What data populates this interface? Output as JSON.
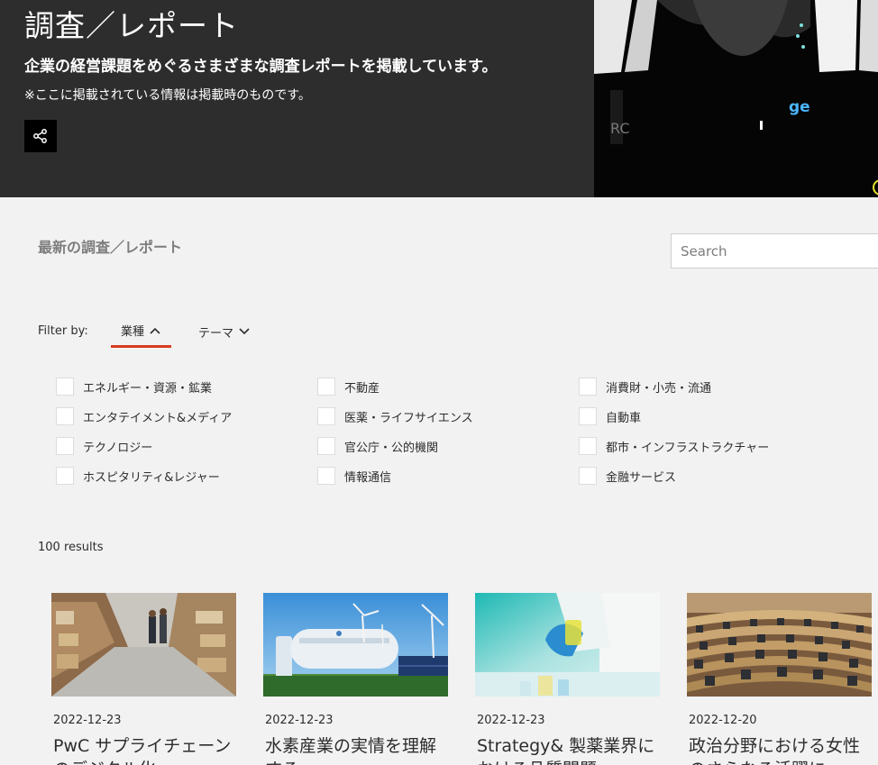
{
  "hero": {
    "title": "調査／レポート",
    "subtitle": "企業の経営課題をめぐるさまざまな調査レポートを掲載しています。",
    "note": "※ここに掲載されている情報は掲載時のものです。",
    "image_caption": "ge"
  },
  "section": {
    "title": "最新の調査／レポート",
    "search_placeholder": "Search"
  },
  "filter": {
    "label": "Filter by:",
    "tabs": [
      {
        "label": "業種"
      },
      {
        "label": "テーマ"
      }
    ],
    "accent_color": "#d93b1f"
  },
  "industries": [
    "エネルギー・資源・鉱業",
    "不動産",
    "消費財・小売・流通",
    "エンタテイメント&メディア",
    "医薬・ライフサイエンス",
    "自動車",
    "テクノロジー",
    "官公庁・公的機関",
    "都市・インフラストラクチャー",
    "ホスピタリティ&レジャー",
    "情報通信",
    "金融サービス"
  ],
  "results": {
    "count_label": "100 results",
    "cards": [
      {
        "date": "2022-12-23",
        "title": "PwC サプライチェーンのデジタル化"
      },
      {
        "date": "2022-12-23",
        "title": "水素産業の実情を理解する"
      },
      {
        "date": "2022-12-23",
        "title": "Strategy& 製薬業界における品質問題"
      },
      {
        "date": "2022-12-20",
        "title": "政治分野における女性のさらなる活躍に"
      }
    ]
  }
}
